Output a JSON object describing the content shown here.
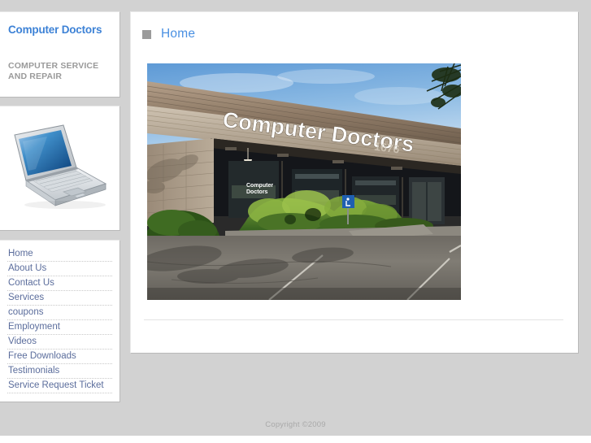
{
  "site": {
    "brand_title": "Computer Doctors",
    "brand_tagline": "COMPUTER SERVICE AND REPAIR",
    "logo_icon": "laptop-computer-image",
    "accent_color": "#3d82d6",
    "heading_color": "#4a90e2",
    "nav_link_color": "#5b6d9c",
    "page_background": "#d2d2d2"
  },
  "navigation": {
    "items": [
      {
        "label": "Home"
      },
      {
        "label": "About Us"
      },
      {
        "label": "Contact Us"
      },
      {
        "label": "Services"
      },
      {
        "label": "coupons"
      },
      {
        "label": "Employment"
      },
      {
        "label": "Videos"
      },
      {
        "label": "Free Downloads"
      },
      {
        "label": "Testimonials"
      },
      {
        "label": "Service Request Ticket"
      }
    ]
  },
  "main": {
    "bullet_icon": "square-bullet-icon",
    "page_title": "Home",
    "photo": {
      "name": "storefront-photo",
      "sign_text": "Computer Doctors",
      "sign_number": "1676",
      "door_text_line1": "Computer",
      "door_text_line2": "Doctors"
    }
  },
  "footer": {
    "copyright": "Copyright ©2009"
  }
}
